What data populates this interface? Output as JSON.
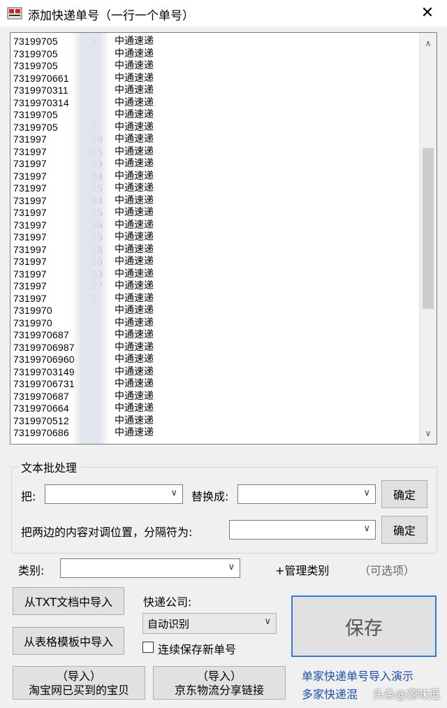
{
  "window": {
    "title": "添加快递单号（一行一个单号）",
    "close": "✕"
  },
  "list": {
    "rows": [
      {
        "num": "73199705",
        "suffix": "5",
        "company": "中通速递"
      },
      {
        "num": "73199705",
        "suffix": "",
        "company": "中通速递"
      },
      {
        "num": "73199705",
        "suffix": "",
        "company": "中通速递"
      },
      {
        "num": "7319970661",
        "suffix": "",
        "company": "中通速递"
      },
      {
        "num": "7319970311",
        "suffix": "",
        "company": "中通速递"
      },
      {
        "num": "7319970314",
        "suffix": "",
        "company": "中通速递"
      },
      {
        "num": "73199705",
        "suffix": "",
        "company": "中通速递"
      },
      {
        "num": "73199705",
        "suffix": "2",
        "company": "中通速递"
      },
      {
        "num": "731997",
        "suffix": "16",
        "company": "中通速递"
      },
      {
        "num": "731997",
        "suffix": "05",
        "company": "中通速递"
      },
      {
        "num": "731997",
        "suffix": "09",
        "company": "中通速递"
      },
      {
        "num": "731997",
        "suffix": "58",
        "company": "中通速递"
      },
      {
        "num": "731997",
        "suffix": "15",
        "company": "中通速递"
      },
      {
        "num": "731997",
        "suffix": "98",
        "company": "中通速递"
      },
      {
        "num": "731997",
        "suffix": "05",
        "company": "中通速递"
      },
      {
        "num": "731997",
        "suffix": "36",
        "company": "中通速递"
      },
      {
        "num": "731997",
        "suffix": "95",
        "company": "中通速递"
      },
      {
        "num": "731997",
        "suffix": "16",
        "company": "中通速递"
      },
      {
        "num": "731997",
        "suffix": "96",
        "company": "中通速递"
      },
      {
        "num": "731997",
        "suffix": "33",
        "company": "中通速递"
      },
      {
        "num": "731997",
        "suffix": "27",
        "company": "中通速递"
      },
      {
        "num": "731997",
        "suffix": "3",
        "company": "中通速递"
      },
      {
        "num": "7319970",
        "suffix": "",
        "company": "中通速递"
      },
      {
        "num": "7319970",
        "suffix": "",
        "company": "中通速递"
      },
      {
        "num": "7319970687",
        "suffix": "",
        "company": "中通速递"
      },
      {
        "num": "73199706987",
        "suffix": "",
        "company": "中通速递"
      },
      {
        "num": "73199706960",
        "suffix": "",
        "company": "中通速递"
      },
      {
        "num": "73199703149",
        "suffix": "",
        "company": "中通速递"
      },
      {
        "num": "73199706731",
        "suffix": "",
        "company": "中通速递"
      },
      {
        "num": "7319970687",
        "suffix": "",
        "company": "中通速递"
      },
      {
        "num": "7319970664",
        "suffix": "",
        "company": "中通速递"
      },
      {
        "num": "7319970512",
        "suffix": "",
        "company": "中通速递"
      },
      {
        "num": "7319970686",
        "suffix": "",
        "company": "中通速递"
      }
    ]
  },
  "batch": {
    "title": "文本批处理",
    "replace_from_label": "把:",
    "replace_to_label": "替换成:",
    "confirm1": "确定",
    "swap_label": "把两边的内容对调位置，分隔符为:",
    "confirm2": "确定"
  },
  "category": {
    "label": "类别:",
    "manage": "+管理类别",
    "hint": "（可选项）"
  },
  "imports": {
    "txt": "从TXT文档中导入",
    "table": "从表格模板中导入",
    "taobao_line1": "（导入）",
    "taobao_line2": "淘宝网已买到的宝贝",
    "jd_line1": "（导入）",
    "jd_line2": "京东物流分享链接"
  },
  "courier": {
    "label": "快递公司:",
    "selected": "自动识别"
  },
  "continuous_save_label": "连续保存新单号",
  "save_label": "保存",
  "links": {
    "single": "单家快递单号导入演示",
    "multi": "多家快递混"
  },
  "watermark": "头条@源味逗"
}
